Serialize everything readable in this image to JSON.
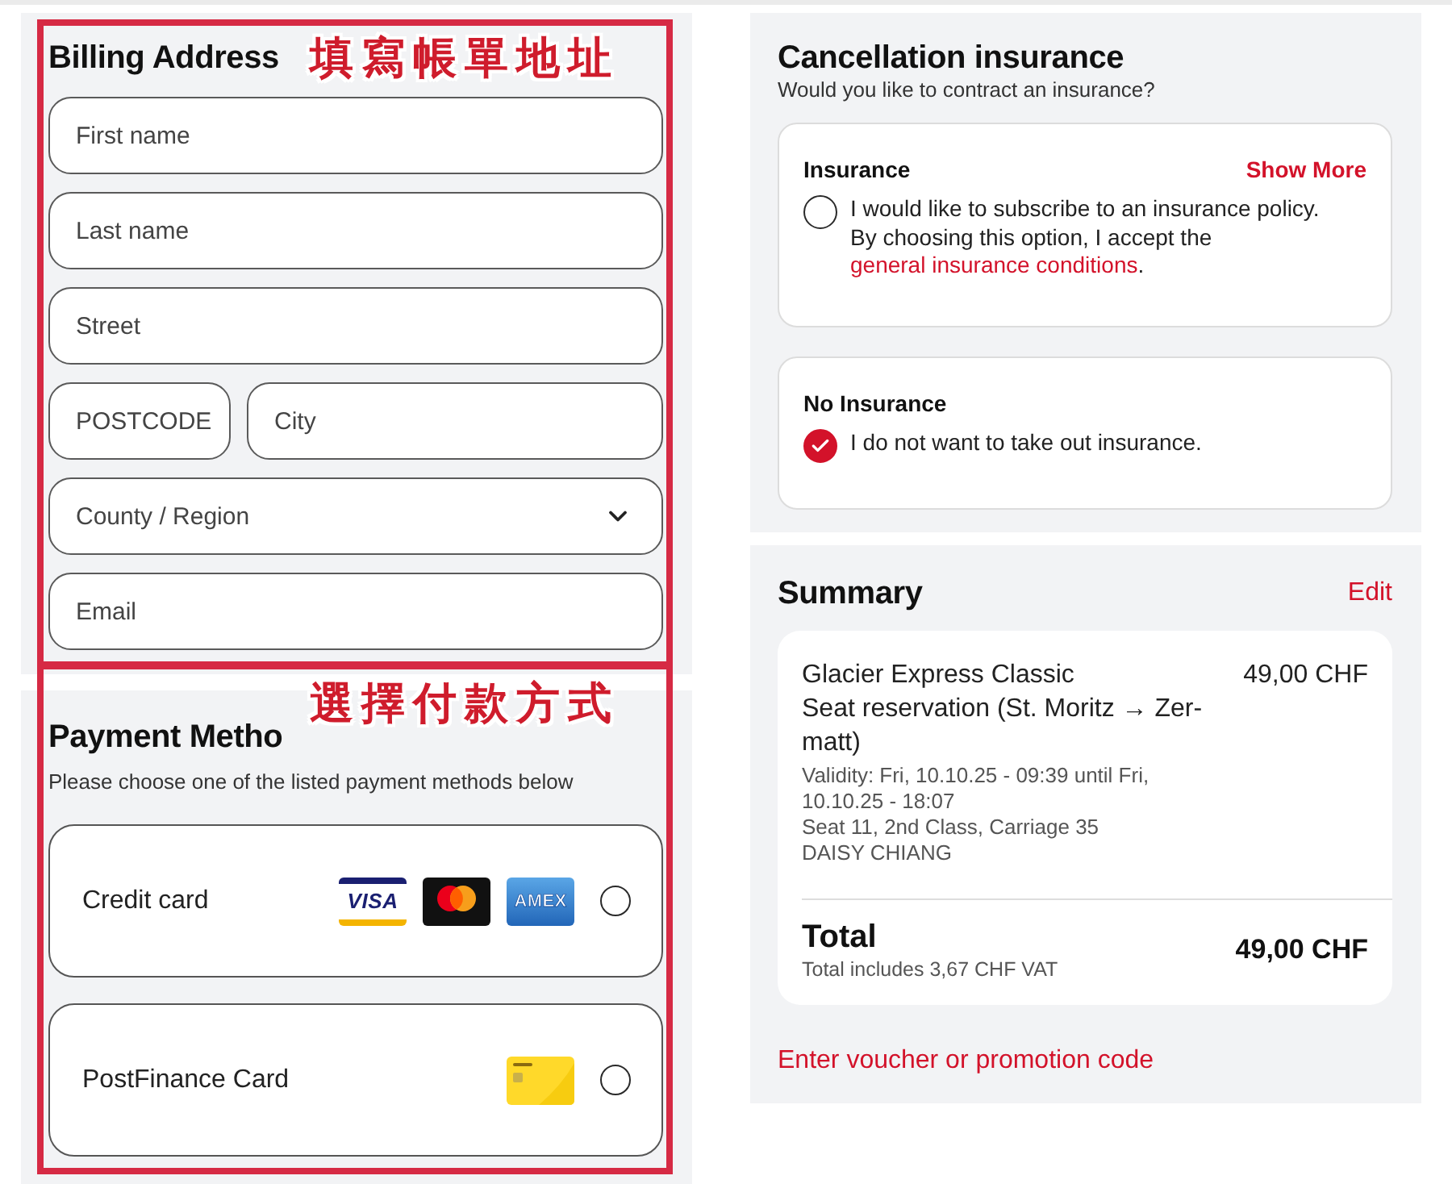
{
  "billing": {
    "title": "Billing Address",
    "annotation": "填寫帳單地址",
    "rows": [
      {
        "fields": [
          {
            "kind": "input",
            "placeholder": "First name"
          }
        ]
      },
      {
        "fields": [
          {
            "kind": "input",
            "placeholder": "Last name"
          }
        ]
      },
      {
        "fields": [
          {
            "kind": "input",
            "placeholder": "Street"
          }
        ]
      },
      {
        "fields": [
          {
            "kind": "input",
            "placeholder": "POSTCODE"
          },
          {
            "kind": "input",
            "placeholder": "City"
          }
        ]
      },
      {
        "fields": [
          {
            "kind": "select",
            "placeholder": "County / Region"
          }
        ]
      },
      {
        "fields": [
          {
            "kind": "input",
            "placeholder": "Email"
          }
        ]
      }
    ]
  },
  "payment": {
    "title": "Payment Metho",
    "annotation": "選擇付款方式",
    "subtitle": "Please choose one of the listed payment methods below",
    "methods": [
      {
        "label": "Credit card",
        "selected": false,
        "logos": [
          {
            "kind": "visa",
            "text": "VISA"
          },
          {
            "kind": "mastercard"
          },
          {
            "kind": "amex",
            "text": "AMEX"
          }
        ]
      },
      {
        "label": "PostFinance Card",
        "selected": false,
        "logos": [
          {
            "kind": "card"
          }
        ]
      }
    ]
  },
  "insurance": {
    "title": "Cancellation insurance",
    "subtitle": "Would you like to contract an insurance?",
    "options": [
      {
        "title": "Insurance",
        "action": "Show More",
        "text": "I would like to subscribe to an insurance policy. By choosing this option, I accept the",
        "link": "general insurance conditions",
        "text_end": ".",
        "selected": false
      },
      {
        "title": "No Insurance",
        "text": "I do not want to take out insurance.",
        "selected": true
      }
    ]
  },
  "summary": {
    "title": "Summary",
    "action": "Edit",
    "items": [
      {
        "name": "Glacier Express Classic",
        "description": "Seat reservation (St. Moritz → Zer-matt)",
        "price": "49,00 CHF",
        "details": [
          "Validity: Fri, 10.10.25 - 09:39 until Fri, 10.10.25 - 18:07",
          "Seat 11, 2nd Class, Carriage 35",
          "DAISY CHIANG"
        ]
      }
    ],
    "total": {
      "label": "Total",
      "note": "Total includes 3,67 CHF VAT",
      "amount": "49,00 CHF"
    },
    "voucher": "Enter voucher or promotion code"
  }
}
